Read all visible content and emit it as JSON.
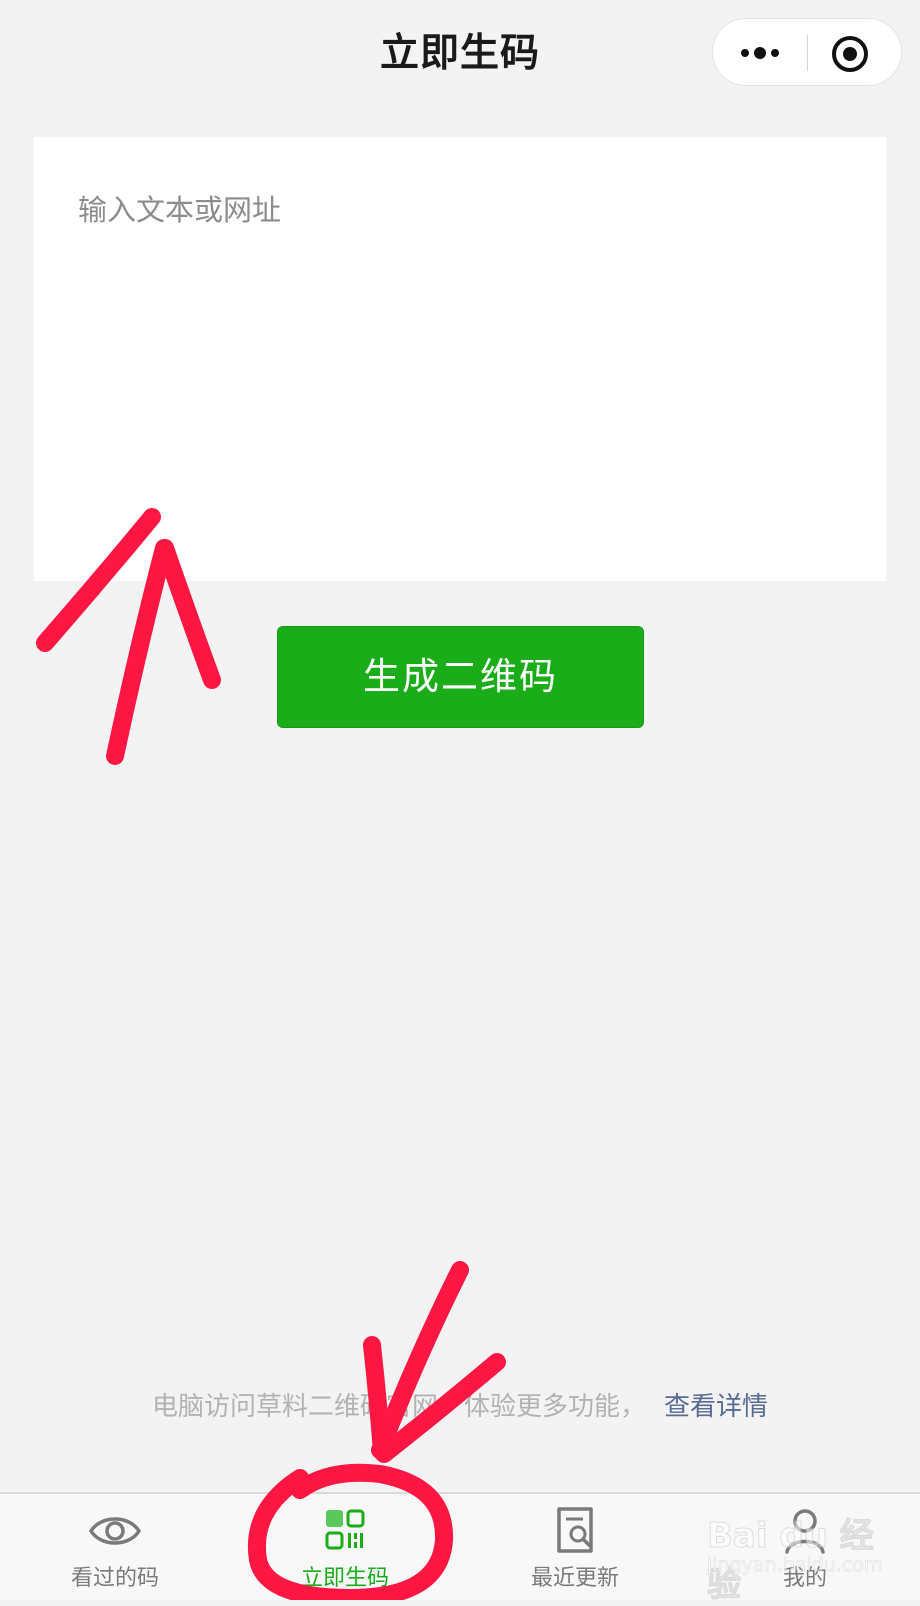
{
  "nav": {
    "title": "立即生码",
    "more_icon": "more-dots-icon",
    "close_icon": "target-circle-icon"
  },
  "input": {
    "placeholder": "输入文本或网址",
    "value": ""
  },
  "generate_button": {
    "label": "生成二维码",
    "color": "#1aad19"
  },
  "footer": {
    "note": "电脑访问草料二维码官网，体验更多功能，",
    "link": "查看详情",
    "link_color": "#576b95"
  },
  "tabbar": {
    "active_color": "#1aad19",
    "inactive_color": "#7a7a7a",
    "items": [
      {
        "label": "看过的码",
        "icon": "eye-icon",
        "active": false
      },
      {
        "label": "立即生码",
        "icon": "qr-code-icon",
        "active": true
      },
      {
        "label": "最近更新",
        "icon": "document-search-icon",
        "active": false
      },
      {
        "label": "我的",
        "icon": "user-icon",
        "active": false
      }
    ]
  },
  "watermark": {
    "main": "Bai du 经验",
    "sub": "jingyan.baidu.com"
  },
  "annotation_color": "#ff1744"
}
